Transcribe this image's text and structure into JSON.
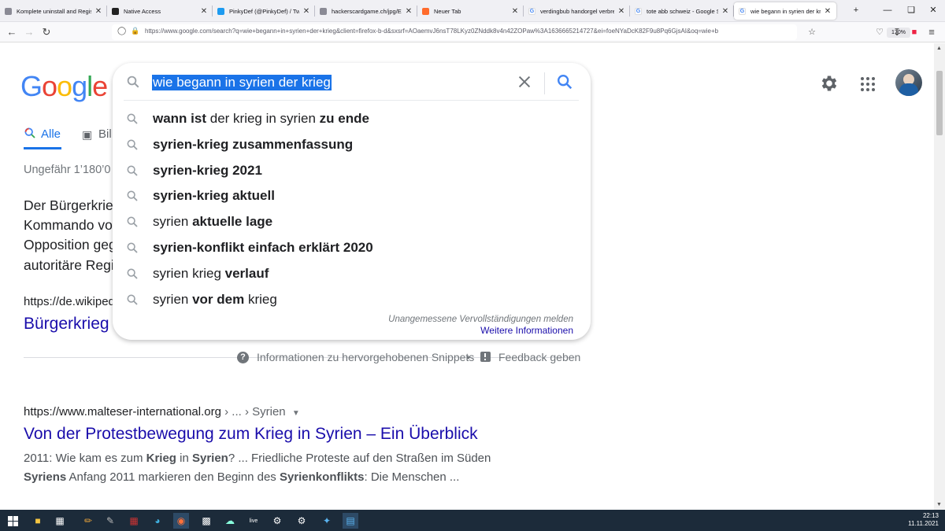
{
  "browser": {
    "tabs": [
      {
        "title": "Komplete uninstall and Regis",
        "icon": "page-icon"
      },
      {
        "title": "Native Access",
        "icon": "native-access-icon"
      },
      {
        "title": "PinkyDef (@PinkyDef) / Twitt",
        "icon": "twitter-icon"
      },
      {
        "title": "hackerscardgame.ch/jpg/EN/#al",
        "icon": "page-icon"
      },
      {
        "title": "Neuer Tab",
        "icon": "firefox-icon"
      },
      {
        "title": "verdingbub handorgel verbre",
        "icon": "google-icon"
      },
      {
        "title": "tote abb schweiz - Google Su",
        "icon": "google-icon"
      },
      {
        "title": "wie begann in syrien der krieg",
        "icon": "google-icon"
      }
    ],
    "new_tab": "+",
    "url": "https://www.google.com/search?q=wie+begann+in+syrien+der+krieg&client=firefox-b-d&sxsrf=AOaemvJ6nsT78LKyz0ZNddk8v4n42ZOPaw%3A1636665214727&ei=foeNYaDcK82F9u8Pq6GjsAI&oq=wie+b",
    "zoom": "170%"
  },
  "google": {
    "logo": [
      "G",
      "o",
      "o",
      "g",
      "l",
      "e"
    ],
    "logo_colors": [
      "#4285f4",
      "#ea4335",
      "#fbbc05",
      "#4285f4",
      "#34a853",
      "#ea4335"
    ],
    "query": "wie begann in syrien der krieg",
    "tabs": {
      "all": "Alle",
      "images": "Bil"
    },
    "result_count": "Ungefähr 1’180’0",
    "suggestions": [
      [
        {
          "t": "wann ist",
          "b": true
        },
        {
          "t": " der krieg in syrien ",
          "b": false
        },
        {
          "t": "zu ende",
          "b": true
        }
      ],
      [
        {
          "t": "syrien-krieg zusammenfassung",
          "b": true
        }
      ],
      [
        {
          "t": "syrien-krieg 2021",
          "b": true
        }
      ],
      [
        {
          "t": "syrien-krieg aktuell",
          "b": true
        }
      ],
      [
        {
          "t": "syrien ",
          "b": false
        },
        {
          "t": "aktuelle lage",
          "b": true
        }
      ],
      [
        {
          "t": "syrien-konflikt einfach erklärt 2020",
          "b": true
        }
      ],
      [
        {
          "t": "syrien krieg ",
          "b": false
        },
        {
          "t": "verlauf",
          "b": true
        }
      ],
      [
        {
          "t": "syrien ",
          "b": false
        },
        {
          "t": "vor dem",
          "b": true
        },
        {
          "t": " krieg",
          "b": false
        }
      ]
    ],
    "report_text": "Unangemessene Vervollständigungen melden",
    "more_info": "Weitere Informationen",
    "snippet_lines": [
      "Der Bürgerkrie",
      "Kommando vor",
      "Opposition geg",
      "autoritäre Regi"
    ],
    "snippet_url": "https://de.wikiped",
    "snippet_title": "Bürgerkrieg",
    "snippet_info": "Informationen zu hervorgehobenen Snippets",
    "dot": "•",
    "feedback": "Feedback geben",
    "result2": {
      "cite": "https://www.malteser-international.org",
      "cite_path": " › ... › Syrien",
      "title": "Von der Protestbewegung zum Krieg in Syrien – Ein Überblick",
      "line1": [
        {
          "t": "2011: Wie kam es zum ",
          "b": false
        },
        {
          "t": "Krieg",
          "b": true
        },
        {
          "t": " in ",
          "b": false
        },
        {
          "t": "Syrien",
          "b": true
        },
        {
          "t": "? ... Friedliche Proteste auf den Straßen im Süden",
          "b": false
        }
      ],
      "line2": [
        {
          "t": "Syriens",
          "b": true
        },
        {
          "t": " Anfang 2011 markieren den Beginn des ",
          "b": false
        },
        {
          "t": "Syrienkonflikts",
          "b": true
        },
        {
          "t": ": Die Menschen ...",
          "b": false
        }
      ]
    }
  },
  "taskbar": {
    "time": "22:13",
    "date": "11.11.2021",
    "live_label": "live"
  }
}
